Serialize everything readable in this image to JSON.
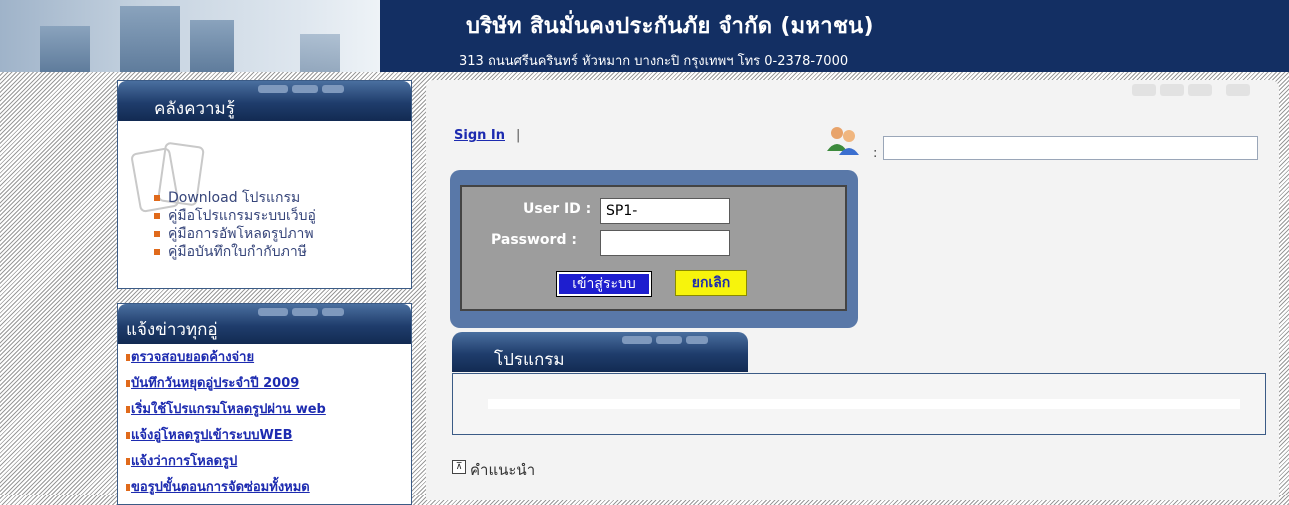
{
  "header": {
    "company_name": "บริษัท สินมั่นคงประกันภัย จำกัด (มหาชน)",
    "address": "313 ถนนศรีนครินทร์ หัวหมาก บางกะปิ กรุงเทพฯ โทร 0-2378-7000"
  },
  "knowledge": {
    "title": "คลังความรู้",
    "items": [
      "Download โปรแกรม",
      "คู่มือโปรแกรมระบบเว็บอู่",
      "คู่มือการอัพโหลดรูปภาพ",
      "คู่มือบันทึกใบกำกับภาษี"
    ]
  },
  "news": {
    "title": "แจ้งข่าวทุกอู่",
    "items": [
      "ตรวจสอบยอดค้างจ่าย",
      "บันทึกวันหยุดอู่ประจำปี 2009",
      "เริ่มใช้โปรแกรมโหลดรูปผ่าน web",
      "แจ้งอู่โหลดรูปเข้าระบบWEB",
      "แจ้งว่าการโหลดรูป",
      "ขอรูปขั้นตอนการจัดซ่อมทั้งหมด"
    ]
  },
  "main": {
    "signin_link": "Sign In",
    "signin_sep": "|",
    "users_colon": ":",
    "search_value": "",
    "login": {
      "userid_label": "User ID :",
      "userid_value": "SP1-",
      "password_label": "Password :",
      "password_value": "",
      "login_button": "เข้าสู่ระบบ",
      "cancel_button": "ยกเลิก"
    },
    "program_title": "โปรแกรม",
    "advice_icon": "⊼",
    "advice_label": "คำแนะนำ"
  },
  "colors": {
    "header_bg": "#132f63",
    "panel_head": "#1f3d6c",
    "login_frame": "#5978a8",
    "login_button": "#1e1ecf",
    "cancel_button": "#f7f40c",
    "link": "#1d2bb0",
    "bullet": "#e06a1b"
  },
  "icons": {
    "header_art": "building-banner-image",
    "users": "users-icon",
    "advice": "expand-arrow-icon"
  }
}
